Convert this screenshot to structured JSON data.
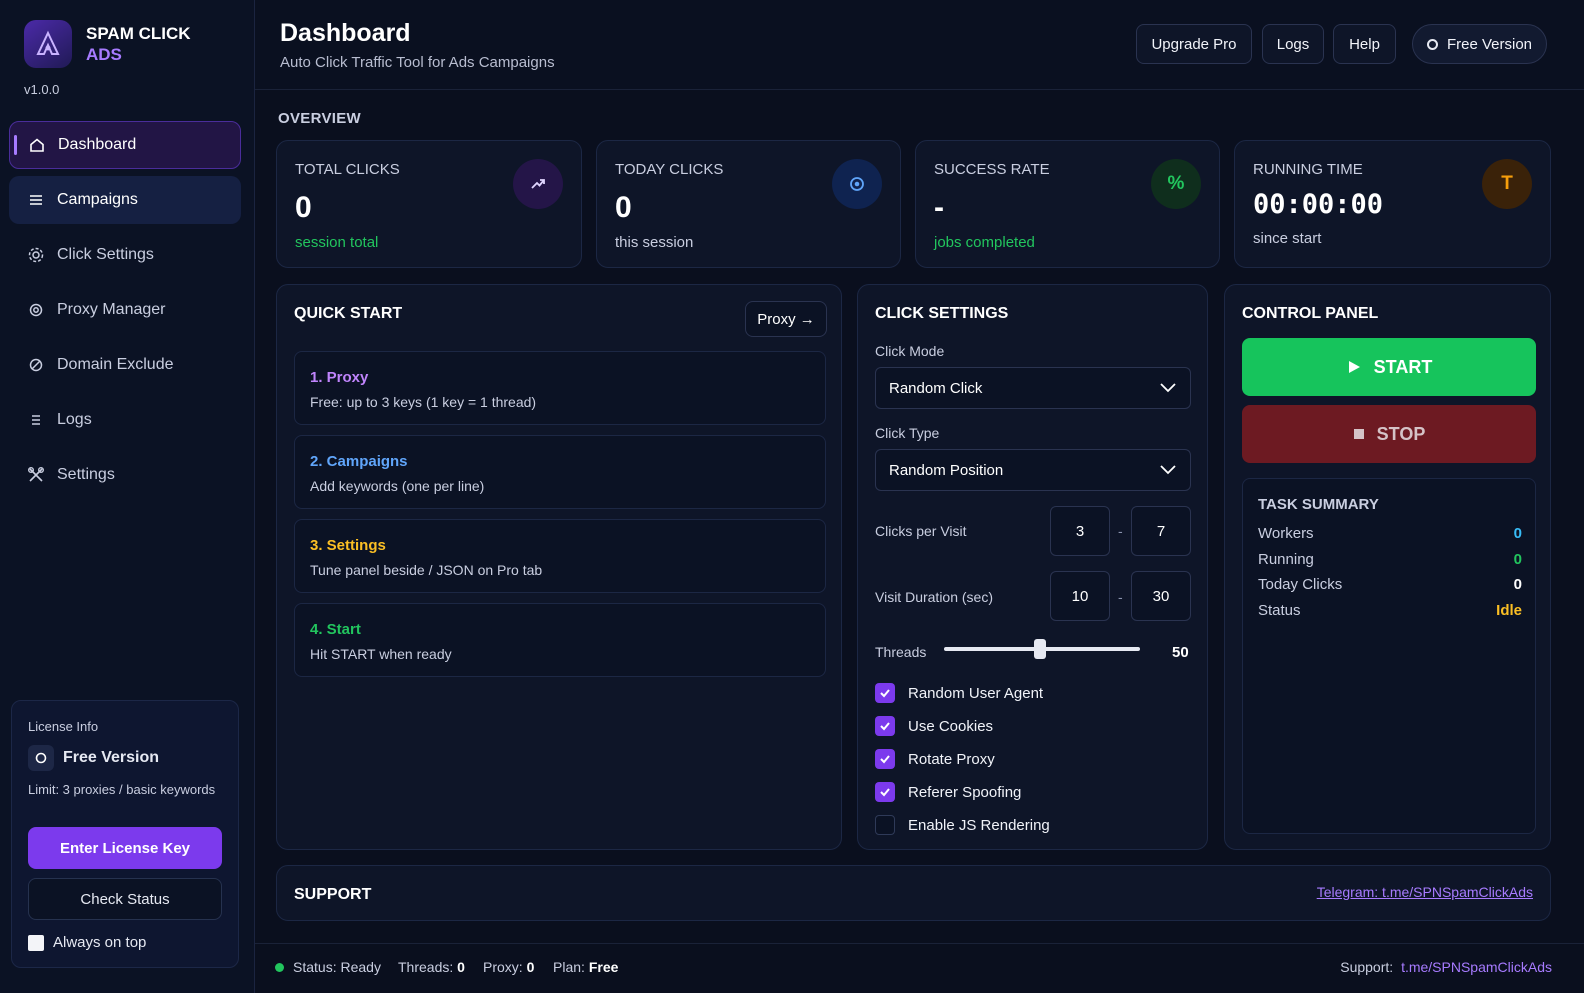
{
  "app": {
    "brand_line1": "SPAM CLICK",
    "brand_line2": "ADS",
    "version": "v1.0.0"
  },
  "sidebar": {
    "items": [
      {
        "label": "Dashboard",
        "icon": "home-icon",
        "state": "active"
      },
      {
        "label": "Campaigns",
        "icon": "list-icon",
        "state": "hover"
      },
      {
        "label": "Click Settings",
        "icon": "gear-icon",
        "state": ""
      },
      {
        "label": "Proxy Manager",
        "icon": "target-icon",
        "state": ""
      },
      {
        "label": "Domain Exclude",
        "icon": "block-icon",
        "state": ""
      },
      {
        "label": "Logs",
        "icon": "lines-icon",
        "state": ""
      },
      {
        "label": "Settings",
        "icon": "tools-icon",
        "state": ""
      }
    ]
  },
  "license": {
    "title": "License Info",
    "version_label": "Free Version",
    "limit": "Limit: 3 proxies / basic keywords",
    "enter_key": "Enter License Key",
    "check_status": "Check Status",
    "always_on_top": "Always on top"
  },
  "header": {
    "title": "Dashboard",
    "subtitle": "Auto Click Traffic Tool for Ads Campaigns",
    "upgrade": "Upgrade Pro",
    "logs": "Logs",
    "help": "Help",
    "free_version": "Free Version"
  },
  "overview": {
    "title": "OVERVIEW",
    "total_clicks": {
      "title": "TOTAL CLICKS",
      "value": "0",
      "sub": "session total"
    },
    "today_clicks": {
      "title": "TODAY CLICKS",
      "value": "0",
      "sub": "this session"
    },
    "success_rate": {
      "title": "SUCCESS RATE",
      "value": "-",
      "sub": "jobs completed",
      "icon_text": "%"
    },
    "running_time": {
      "title": "RUNNING TIME",
      "value": "00:00:00",
      "sub": "since start",
      "icon_text": "T"
    }
  },
  "quick_start": {
    "title": "QUICK START",
    "proxy_btn": "Proxy →",
    "steps": [
      {
        "title": "1. Proxy",
        "desc": "Free: up to 3 keys (1 key = 1 thread)",
        "color": "#c084fc"
      },
      {
        "title": "2. Campaigns",
        "desc": "Add keywords (one per line)",
        "color": "#60a5fa"
      },
      {
        "title": "3. Settings",
        "desc": "Tune panel beside / JSON on Pro tab",
        "color": "#fbbf24"
      },
      {
        "title": "4. Start",
        "desc": "Hit START when ready",
        "color": "#22c55e"
      }
    ]
  },
  "click_settings": {
    "title": "CLICK SETTINGS",
    "click_mode_label": "Click Mode",
    "click_mode_value": "Random Click",
    "click_type_label": "Click Type",
    "click_type_value": "Random Position",
    "clicks_per_visit_label": "Clicks per Visit",
    "clicks_min": "3",
    "clicks_max": "7",
    "visit_duration_label": "Visit Duration (sec)",
    "duration_min": "10",
    "duration_max": "30",
    "range_sep": "-",
    "threads_label": "Threads",
    "threads_value": "50",
    "checkboxes": [
      {
        "label": "Random User Agent",
        "checked": true
      },
      {
        "label": "Use Cookies",
        "checked": true
      },
      {
        "label": "Rotate Proxy",
        "checked": true
      },
      {
        "label": "Referer Spoofing",
        "checked": true
      },
      {
        "label": "Enable JS Rendering",
        "checked": false
      }
    ]
  },
  "control_panel": {
    "title": "CONTROL PANEL",
    "start": "START",
    "stop": "STOP",
    "summary_title": "TASK SUMMARY",
    "summary": [
      {
        "key": "Workers",
        "value": "0",
        "color": "#38bdf8"
      },
      {
        "key": "Running",
        "value": "0",
        "color": "#22c55e"
      },
      {
        "key": "Today Clicks",
        "value": "0",
        "color": "#ffffff"
      },
      {
        "key": "Status",
        "value": "Idle",
        "color": "#fbbf24"
      }
    ]
  },
  "support": {
    "title": "SUPPORT",
    "link": "Telegram: t.me/SPNSpamClickAds"
  },
  "statusbar": {
    "status": "Status: Ready",
    "threads_label": "Threads:",
    "threads": "0",
    "proxy_label": "Proxy:",
    "proxy": "0",
    "plan_label": "Plan:",
    "plan": "Free",
    "support_label": "Support:",
    "support_link": "t.me/SPNSpamClickAds"
  },
  "colors": {
    "accent": "#7c3aed",
    "accent_light": "#a77bff",
    "success": "#22c55e",
    "danger": "#6d1a22",
    "warning": "#fbbf24"
  }
}
